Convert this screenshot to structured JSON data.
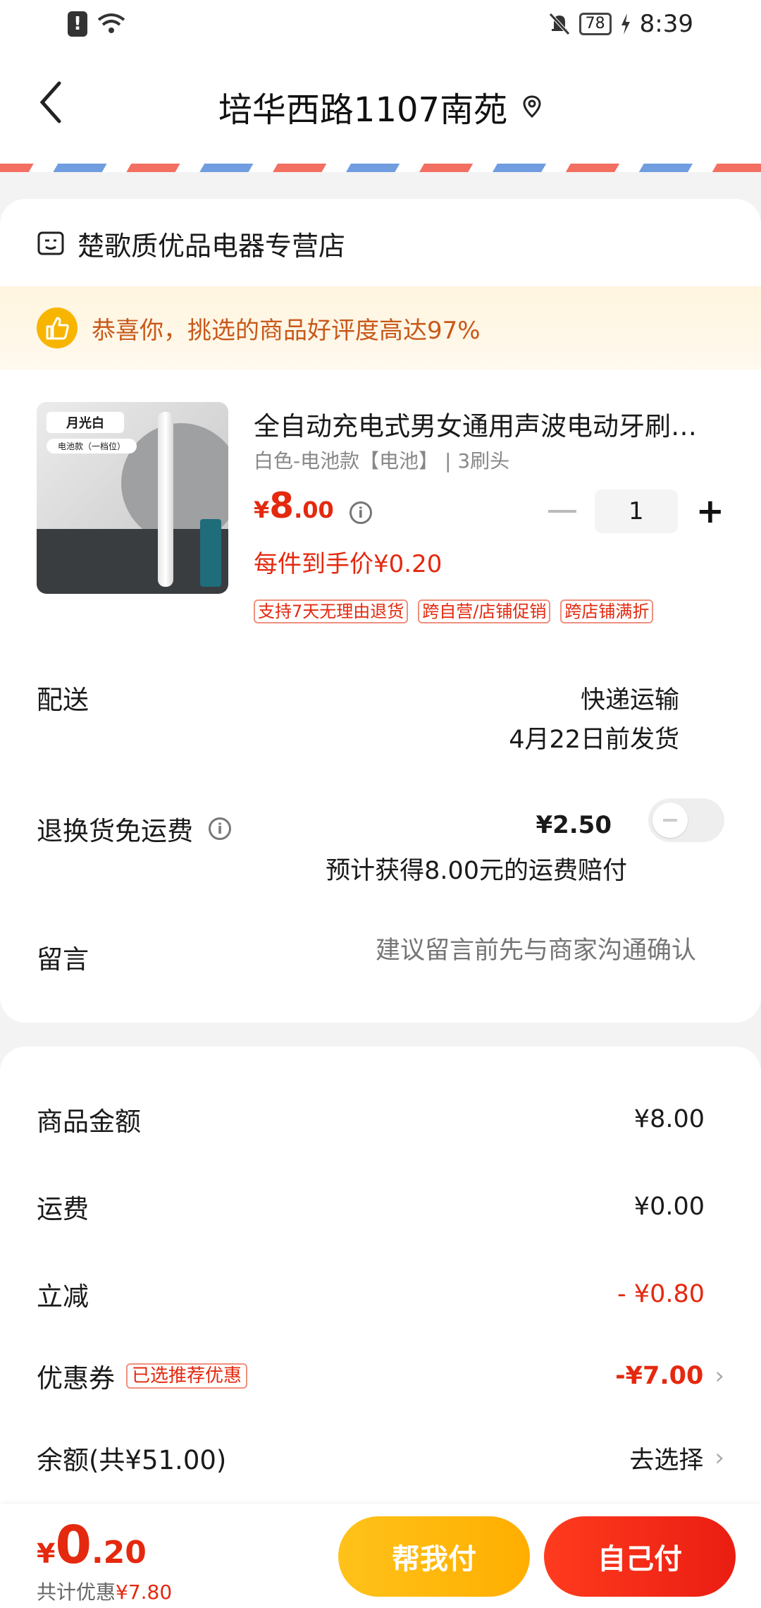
{
  "status_bar": {
    "time": "8:39",
    "battery": "78"
  },
  "header": {
    "title": "培华西路1107南苑"
  },
  "store": {
    "name": "楚歌质优品电器专营店"
  },
  "praise": {
    "text": "恭喜你，挑选的商品好评度高达97%"
  },
  "product": {
    "image_label": "月光白",
    "image_sub": "电池款（一档位）",
    "name": "全自动充电式男女通用声波电动牙刷…",
    "spec": "白色-电池款【电池】 | 3刷头",
    "price_symbol": "¥",
    "price_int": "8",
    "price_dec": ".00",
    "quantity": "1",
    "unit_price": "每件到手价¥0.20",
    "tags": [
      "支持7天无理由退货",
      "跨自营/店铺促销",
      "跨店铺满折"
    ]
  },
  "shipping": {
    "label": "配送",
    "method": "快递运输",
    "date": "4月22日前发货"
  },
  "refund": {
    "label": "退换货免运费",
    "price": "¥2.50",
    "note": "预计获得8.00元的运费赔付",
    "enabled": false
  },
  "message": {
    "label": "留言",
    "placeholder": "建议留言前先与商家沟通确认"
  },
  "summary": {
    "goods_label": "商品金额",
    "goods_value": "¥8.00",
    "freight_label": "运费",
    "freight_value": "¥0.00",
    "reduce_label": "立减",
    "reduce_value": "- ¥0.80",
    "coupon_label": "优惠券",
    "coupon_tag": "已选推荐优惠",
    "coupon_value": "-¥7.00",
    "balance_label": "余额(共¥51.00)",
    "balance_value": "去选择"
  },
  "footer": {
    "total_symbol": "¥",
    "total_int": "0",
    "total_dec": ".20",
    "discount_label": "共计优惠",
    "discount_value": "¥7.80",
    "help_pay": "帮我付",
    "self_pay": "自己付"
  },
  "colors": {
    "accent_red": "#e4290f",
    "accent_yellow": "#ffb800",
    "praise_text": "#c8591b"
  }
}
